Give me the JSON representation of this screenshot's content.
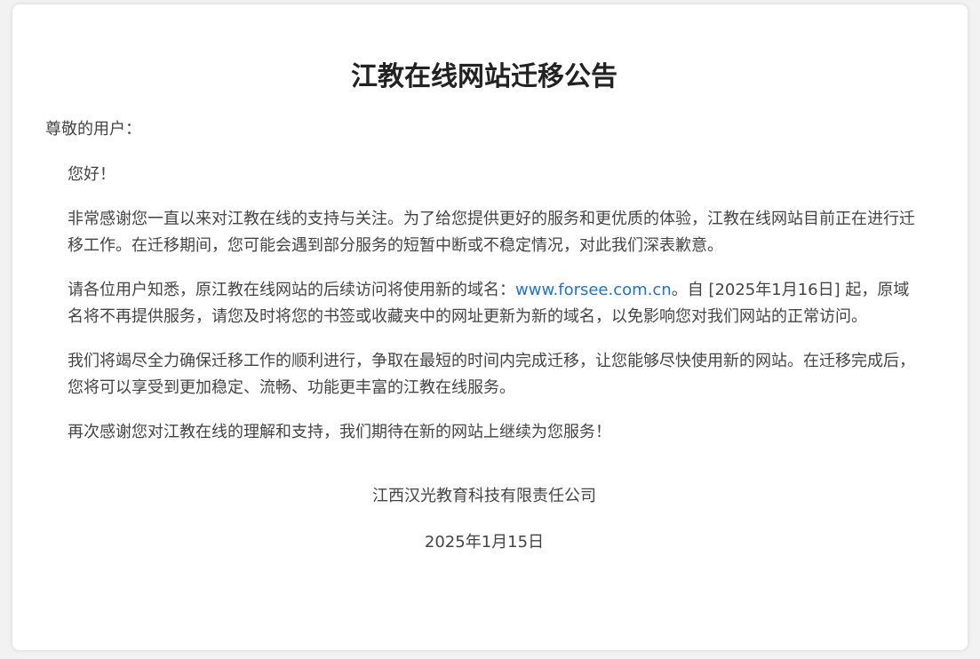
{
  "notice": {
    "title": "江教在线网站迁移公告",
    "greeting": "尊敬的用户：",
    "hello": "您好！",
    "para1": "非常感谢您一直以来对江教在线的支持与关注。为了给您提供更好的服务和更优质的体验，江教在线网站目前正在进行迁移工作。在迁移期间，您可能会遇到部分服务的短暂中断或不稳定情况，对此我们深表歉意。",
    "para2_before": "请各位用户知悉，原江教在线网站的后续访问将使用新的域名：",
    "para2_link": "www.forsee.com.cn",
    "para2_after": "。自 [2025年1月16日] 起，原域名将不再提供服务，请您及时将您的书签或收藏夹中的网址更新为新的域名，以免影响您对我们网站的正常访问。",
    "para3": "我们将竭尽全力确保迁移工作的顺利进行，争取在最短的时间内完成迁移，让您能够尽快使用新的网站。在迁移完成后，您将可以享受到更加稳定、流畅、功能更丰富的江教在线服务。",
    "para4": "再次感谢您对江教在线的理解和支持，我们期待在新的网站上继续为您服务！",
    "company": "江西汉光教育科技有限责任公司",
    "date": "2025年1月15日"
  },
  "colors": {
    "link": "#1a73d8",
    "text": "#444444",
    "title": "#222222",
    "background": "#f2f2f2",
    "card": "#ffffff"
  }
}
